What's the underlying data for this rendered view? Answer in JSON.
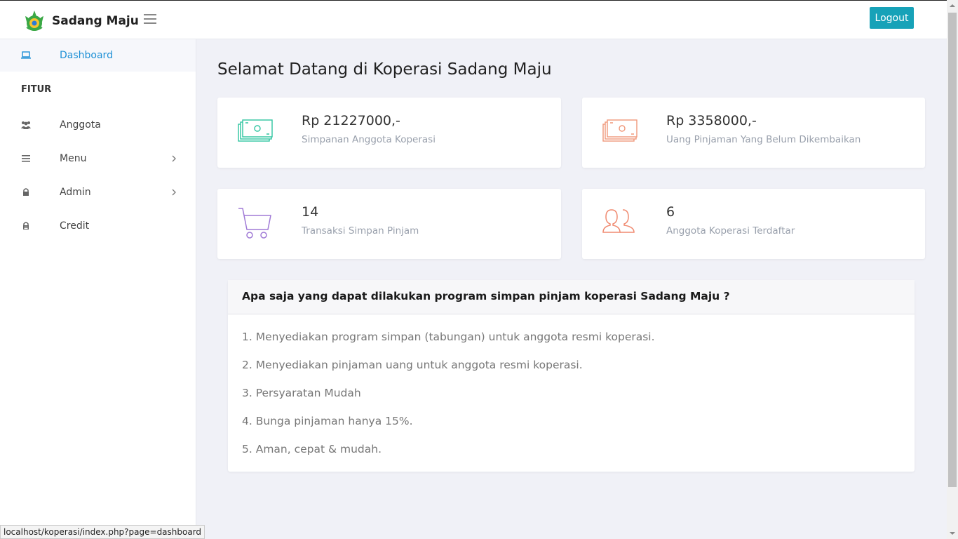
{
  "brand": {
    "name": "Sadang Maju"
  },
  "topbar": {
    "logout_label": "Logout"
  },
  "sidebar": {
    "items_top": [
      {
        "label": "Dashboard",
        "icon": "laptop-icon",
        "active": true
      }
    ],
    "section_heading": "FITUR",
    "items": [
      {
        "label": "Anggota",
        "icon": "users-icon"
      },
      {
        "label": "Menu",
        "icon": "list-icon"
      },
      {
        "label": "Admin",
        "icon": "lock-icon"
      },
      {
        "label": "Credit",
        "icon": "lock-open-icon"
      }
    ]
  },
  "main": {
    "title": "Selamat Datang di Koperasi Sadang Maju",
    "cards": [
      {
        "value": "Rp 21227000,-",
        "label": "Simpanan Anggota Koperasi",
        "icon": "money-stack-icon",
        "color": "#2ec4a0"
      },
      {
        "value": "Rp 3358000,-",
        "label": "Uang Pinjaman Yang Belum Dikembaikan",
        "icon": "money-stack-icon",
        "color": "#f0987a"
      },
      {
        "value": "14",
        "label": "Transaksi Simpan Pinjam",
        "icon": "shopping-cart-icon",
        "color": "#a07ad6"
      },
      {
        "value": "6",
        "label": "Anggota Koperasi Terdaftar",
        "icon": "users-outline-icon",
        "color": "#f08a70"
      }
    ],
    "info": {
      "heading": "Apa saja yang dapat dilakukan program simpan pinjam koperasi Sadang Maju ?",
      "items": [
        "1. Menyediakan program simpan (tabungan) untuk anggota resmi koperasi.",
        "2. Menyediakan pinjaman uang untuk anggota resmi koperasi.",
        "3. Persyaratan Mudah",
        "4. Bunga pinjaman hanya 15%.",
        "5. Aman, cepat & mudah."
      ]
    }
  },
  "status_bar": {
    "url": "localhost/koperasi/index.php?page=dashboard"
  },
  "colors": {
    "accent": "#17a2b8",
    "active_link": "#1e90d6"
  }
}
